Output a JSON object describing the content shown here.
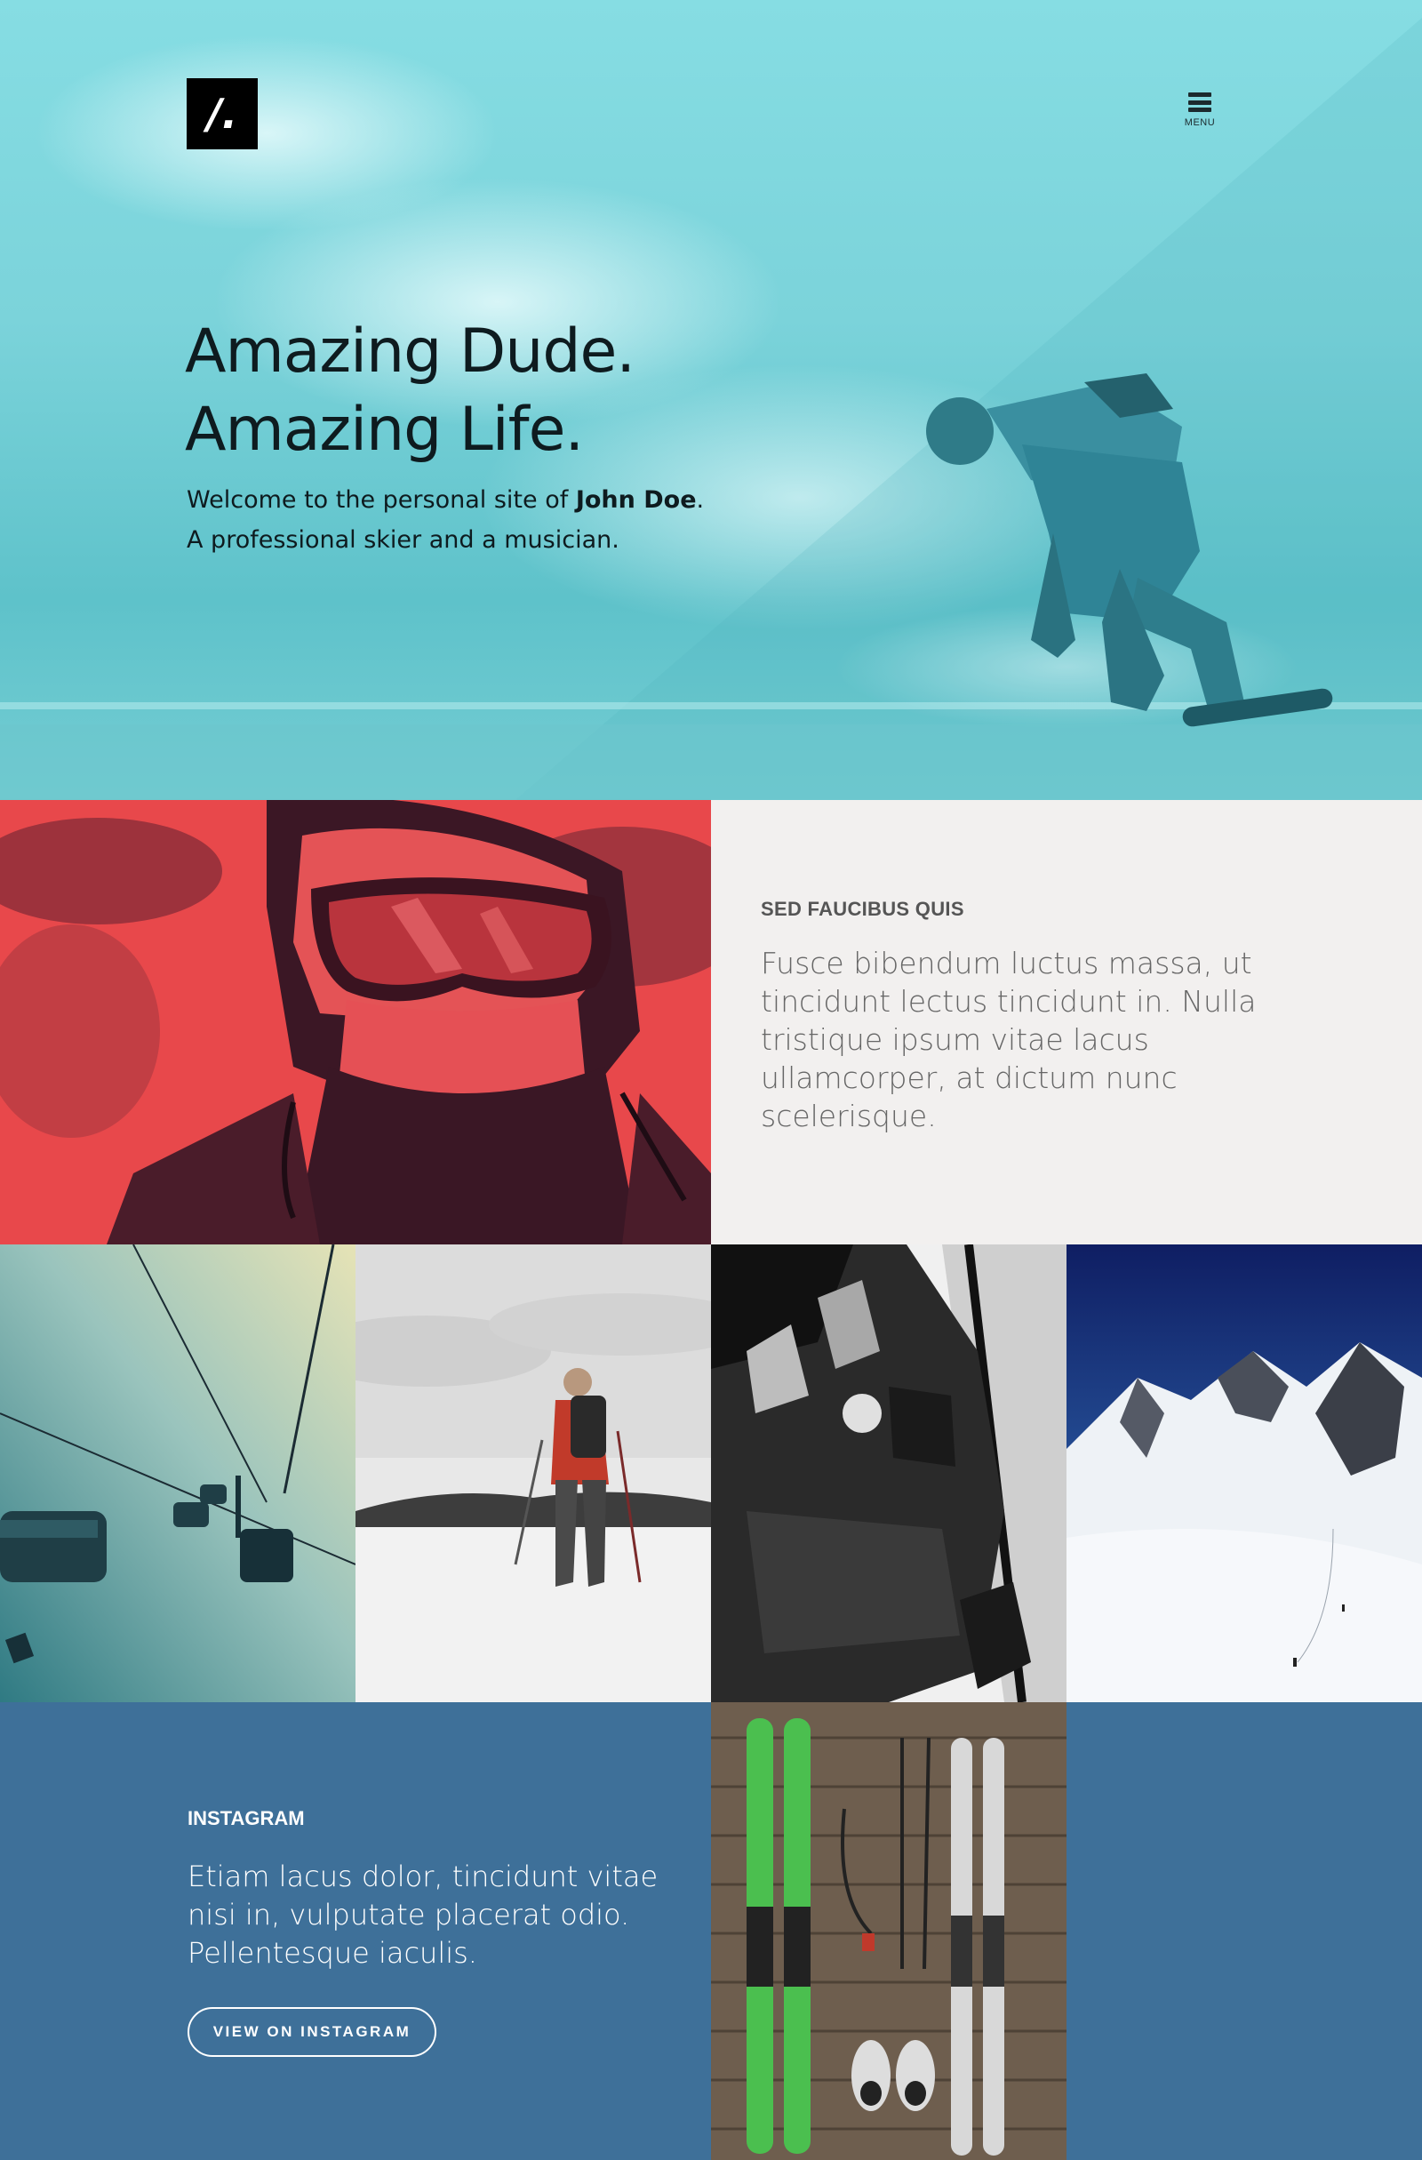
{
  "header": {
    "logo_text": "/.",
    "menu_label": "MENU"
  },
  "hero": {
    "title_line1": "Amazing Dude.",
    "title_line2": "Amazing Life.",
    "subtitle_prefix": "Welcome to the personal site of ",
    "subtitle_name": "John Doe",
    "subtitle_suffix": ".",
    "subtitle_line2": "A professional skier and a musician."
  },
  "feature": {
    "heading": "SED FAUCIBUS QUIS",
    "text": "Fusce bibendum luctus massa, ut tincidunt lectus tincidunt in. Nulla tristique ipsum vitae lacus ullamcorper, at dictum nunc scelerisque."
  },
  "gallery": {
    "images": [
      {
        "name": "chairlift-photo"
      },
      {
        "name": "hiker-photo"
      },
      {
        "name": "ski-boot-photo"
      },
      {
        "name": "mountain-photo"
      }
    ]
  },
  "instagram": {
    "heading": "INSTAGRAM",
    "text": "Etiam lacus dolor, tincidunt vitae nisi in, vulputate placerat odio. Pellentesque iaculis.",
    "button_label": "VIEW ON INSTAGRAM"
  },
  "colors": {
    "hero_bg": "#7bd3da",
    "feature_bg": "#f2f0ef",
    "instagram_bg": "#3e7099",
    "goggle_tint": "#e64a4a"
  }
}
